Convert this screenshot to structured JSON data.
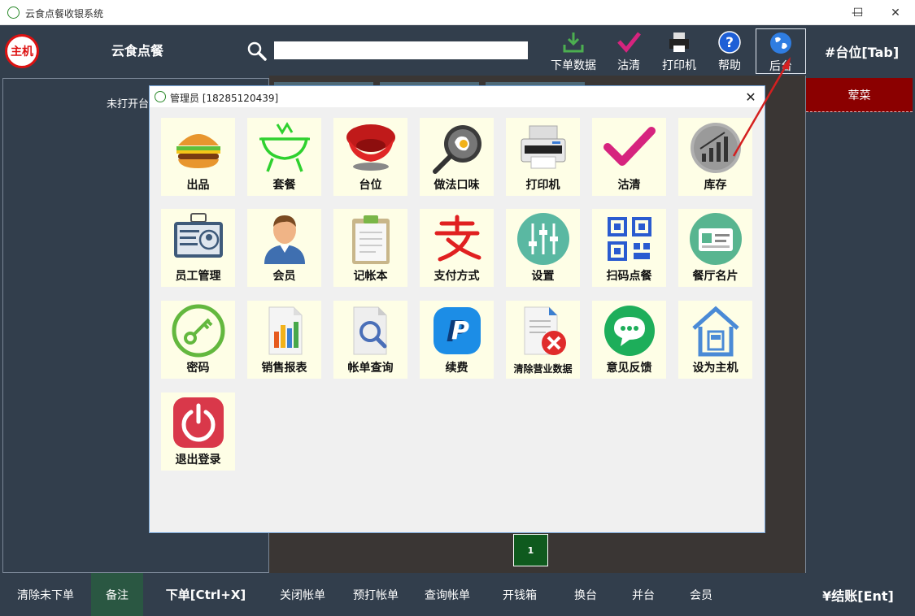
{
  "window": {
    "title": "云食点餐收银系统",
    "minimize": "—",
    "maximize": "☐",
    "close": "✕"
  },
  "header": {
    "logo_text": "主机",
    "brand": "云食点餐",
    "search_placeholder": "",
    "tools": [
      {
        "label": "下单数据",
        "icon": "download-icon"
      },
      {
        "label": "沽清",
        "icon": "check-icon"
      },
      {
        "label": "打印机",
        "icon": "printer-icon"
      },
      {
        "label": "帮助",
        "icon": "help-icon"
      },
      {
        "label": "后台",
        "icon": "globe-icon"
      }
    ],
    "table_tab": "#台位[Tab]"
  },
  "main": {
    "left_status": "未打开台",
    "right_category": "荤菜",
    "page_number": "1"
  },
  "bottom": {
    "buttons": [
      "清除未下单",
      "备注",
      "下单[Ctrl+X]",
      "关闭帐单",
      "预打帐单",
      "查询帐单",
      "开钱箱",
      "换台",
      "并台",
      "会员"
    ],
    "checkout": "¥结账[Ent]"
  },
  "dialog": {
    "title": "管理员 [18285120439]",
    "close": "✕",
    "tiles": [
      {
        "label": "出品",
        "icon": "burger-icon"
      },
      {
        "label": "套餐",
        "icon": "hotpot-icon"
      },
      {
        "label": "台位",
        "icon": "sofa-icon"
      },
      {
        "label": "做法口味",
        "icon": "frying-pan-icon"
      },
      {
        "label": "打印机",
        "icon": "printer-icon"
      },
      {
        "label": "沽清",
        "icon": "check-icon"
      },
      {
        "label": "库存",
        "icon": "bar-chart-icon"
      },
      {
        "label": "员工管理",
        "icon": "id-card-icon"
      },
      {
        "label": "会员",
        "icon": "person-icon"
      },
      {
        "label": "记帐本",
        "icon": "clipboard-icon"
      },
      {
        "label": "支付方式",
        "icon": "alipay-icon"
      },
      {
        "label": "设置",
        "icon": "sliders-icon"
      },
      {
        "label": "扫码点餐",
        "icon": "qr-code-icon"
      },
      {
        "label": "餐厅名片",
        "icon": "business-card-icon"
      },
      {
        "label": "密码",
        "icon": "key-icon"
      },
      {
        "label": "销售报表",
        "icon": "report-icon"
      },
      {
        "label": "帐单查询",
        "icon": "document-search-icon"
      },
      {
        "label": "续费",
        "icon": "paypal-icon"
      },
      {
        "label": "清除营业数据",
        "icon": "delete-document-icon"
      },
      {
        "label": "意见反馈",
        "icon": "chat-icon"
      },
      {
        "label": "设为主机",
        "icon": "house-icon"
      },
      {
        "label": "退出登录",
        "icon": "power-icon"
      }
    ]
  },
  "colors": {
    "header_bg": "#323e4c",
    "accent_red": "#8b0000",
    "tile_bg": "#fefee6",
    "page_green": "#0f5a1e"
  }
}
